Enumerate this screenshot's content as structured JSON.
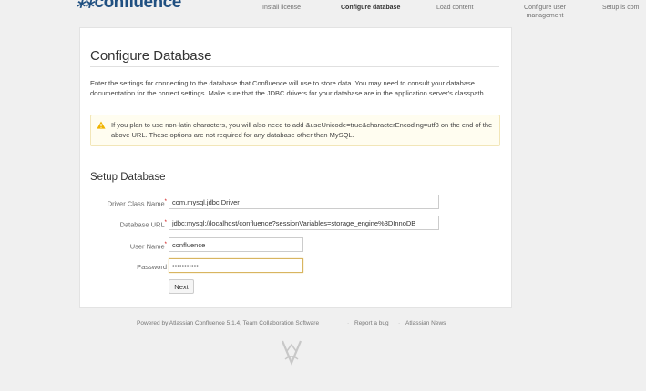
{
  "header": {
    "logo_text": "confluence",
    "logo_mark": "⁂",
    "steps": [
      {
        "label": "Install license"
      },
      {
        "label": "Configure database"
      },
      {
        "label": "Load content"
      },
      {
        "label": "Configure user management"
      },
      {
        "label": "Setup is com"
      }
    ]
  },
  "main": {
    "title": "Configure Database",
    "intro": "Enter the settings for connecting to the database that Confluence will use to store data. You may need to consult your database documentation for the correct settings. Make sure that the JDBC drivers for your database are in the application server's classpath.",
    "warning": "If you plan to use non-latin characters, you will also need to add &useUnicode=true&characterEncoding=utf8 on the end of the above URL. These options are not required for any database other than MySQL.",
    "section_title": "Setup Database",
    "form": {
      "driver_label": "Driver Class Name",
      "driver_value": "com.mysql.jdbc.Driver",
      "url_label": "Database URL",
      "url_value": "jdbc:mysql://localhost/confluence?sessionVariables=storage_engine%3DInnoDB",
      "user_label": "User Name",
      "user_value": "confluence",
      "password_label": "Password",
      "password_value": "•••••••••••",
      "required_mark": "*",
      "next_label": "Next"
    }
  },
  "footer": {
    "powered": "Powered by Atlassian Confluence 5.1.4, Team Collaboration Software",
    "report": "Report a bug",
    "news": "Atlassian News",
    "separator": "·"
  },
  "colors": {
    "brand": "#205081",
    "warning_icon": "#f0b400",
    "focus_border": "#d8b560"
  },
  "icons": {
    "warning": "warning-icon",
    "atlassian": "atlassian-logo-icon"
  }
}
